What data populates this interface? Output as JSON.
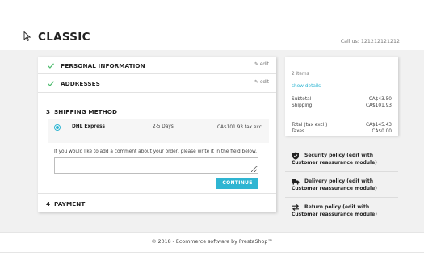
{
  "header": {
    "logo_text": "CLASSIC",
    "call_us": "Call us: 121212121212"
  },
  "checkout": {
    "steps": [
      {
        "number": "",
        "title": "PERSONAL INFORMATION",
        "edit": "edit",
        "status": "complete"
      },
      {
        "number": "",
        "title": "ADDRESSES",
        "edit": "edit",
        "status": "complete"
      },
      {
        "number": "3",
        "title": "SHIPPING METHOD",
        "status": "current"
      },
      {
        "number": "4",
        "title": "PAYMENT",
        "status": "pending"
      }
    ],
    "carrier": {
      "name": "DHL Express",
      "delay": "2-5 Days",
      "price": "CA$101.93 tax excl."
    },
    "comment_label": "If you would like to add a comment about your order, please write it in the field below.",
    "comment_value": "",
    "continue_label": "CONTINUE"
  },
  "summary": {
    "items_count": "2 items",
    "show_details": "show details",
    "subtotal_label": "Subtotal",
    "subtotal_value": "CA$43.50",
    "shipping_label": "Shipping",
    "shipping_value": "CA$101.93",
    "total_label": "Total (tax excl.)",
    "total_value": "CA$145.43",
    "taxes_label": "Taxes",
    "taxes_value": "CA$0.00"
  },
  "reassurance": [
    {
      "icon": "shield-icon",
      "text": "Security policy (edit with Customer reassurance module)"
    },
    {
      "icon": "truck-icon",
      "text": "Delivery policy (edit with Customer reassurance module)"
    },
    {
      "icon": "arrows-icon",
      "text": "Return policy (edit with Customer reassurance module)"
    }
  ],
  "footer": {
    "text": "© 2018 - Ecommerce software by PrestaShop™"
  },
  "colors": {
    "accent": "#2fb5d2",
    "check": "#4cbb6c",
    "background": "#f1f1f1"
  }
}
